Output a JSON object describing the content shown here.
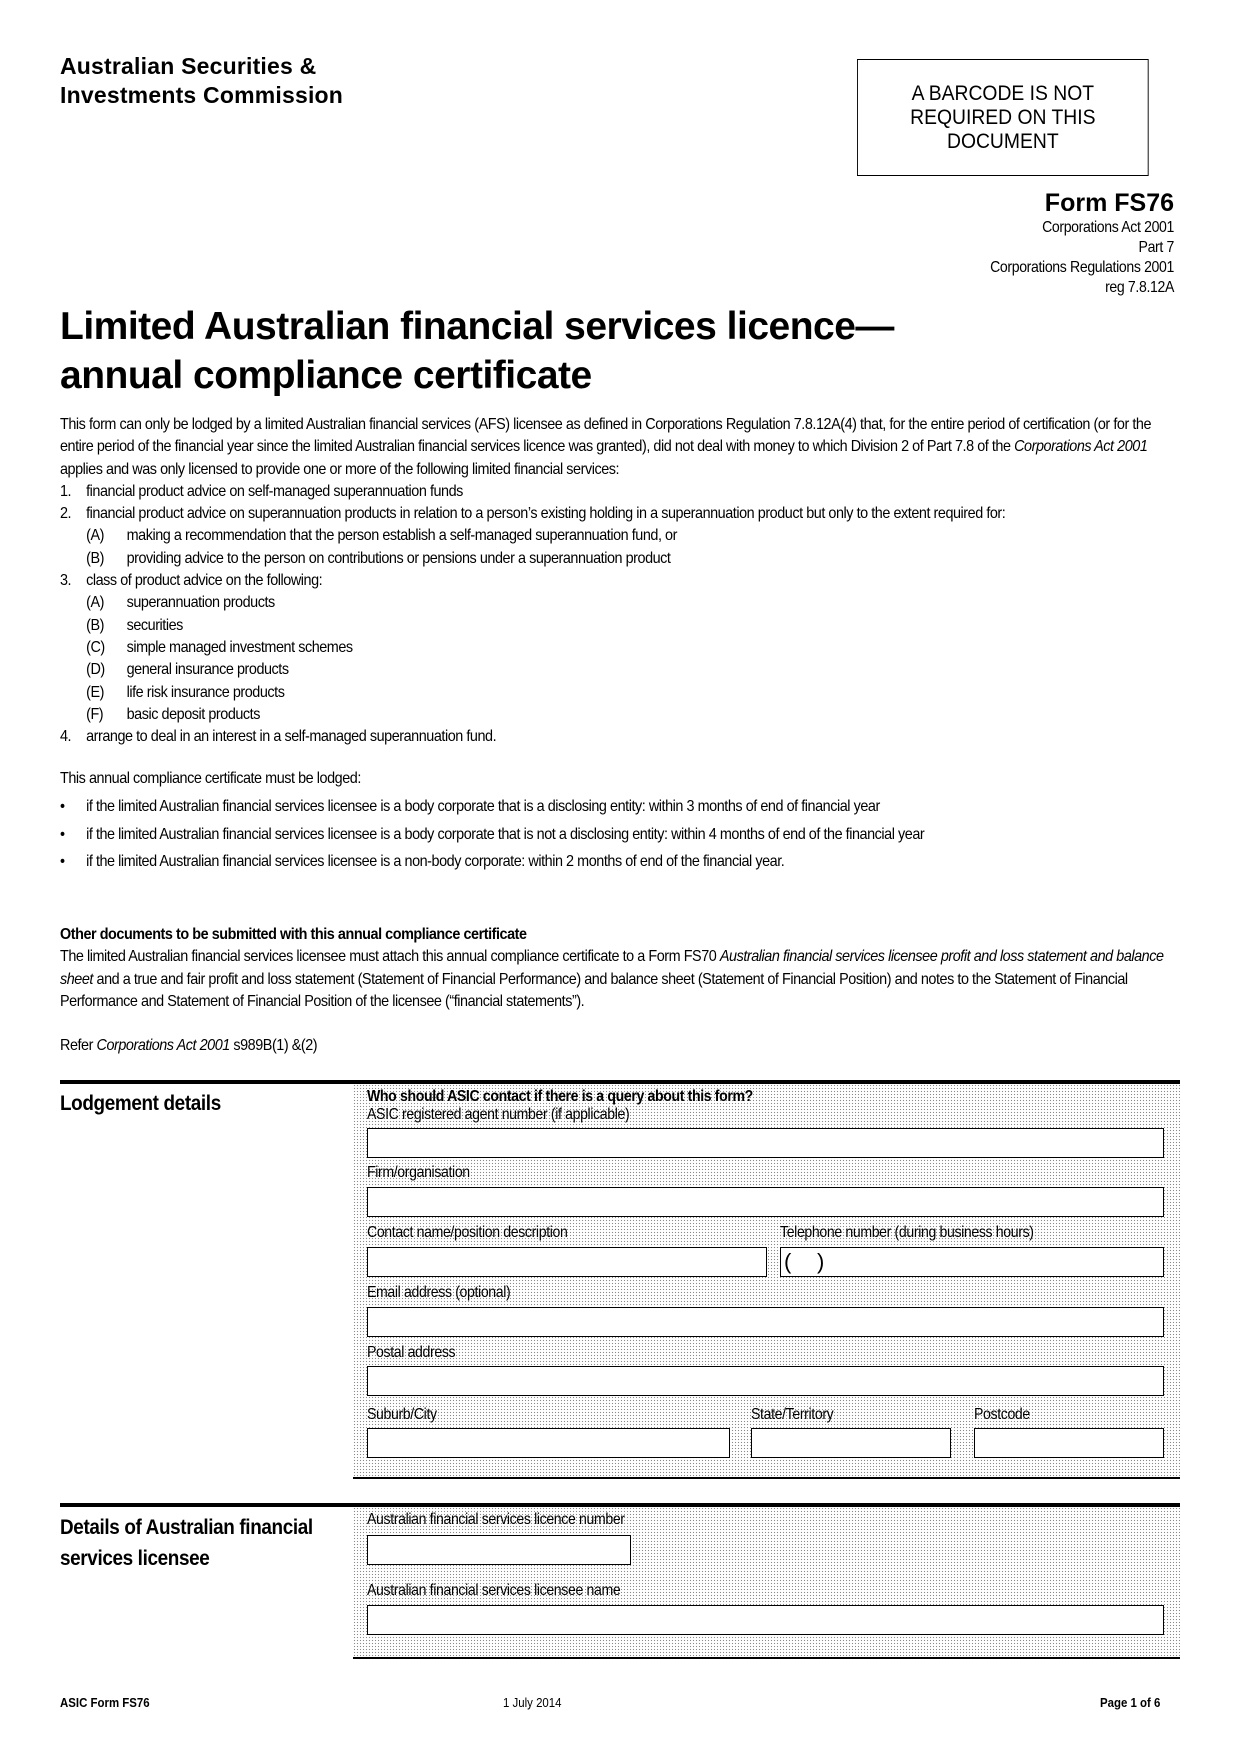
{
  "header": {
    "org_line1": "Australian Securities &",
    "org_line2": "Investments Commission",
    "barcode_notice": [
      "A BARCODE IS NOT",
      "REQUIRED ON THIS",
      "DOCUMENT"
    ],
    "form_id": "Form FS76",
    "legislation": [
      "Corporations Act 2001",
      "Part 7",
      "Corporations Regulations 2001",
      "reg 7.8.12A"
    ]
  },
  "title": {
    "line1": "Limited Australian financial services licence—",
    "line2": "annual compliance certificate"
  },
  "intro": {
    "para_pre": "This form can only be lodged by a limited Australian financial services (AFS) licensee as defined in Corporations Regulation 7.8.12A(4) that, for the entire period of certification (or for the entire period of the financial year since the limited Australian financial services licence was granted), did not deal with money to which Division 2 of Part 7.8 of the ",
    "para_italic": "Corporations Act 2001",
    "para_post": " applies and was only licensed to provide one or more of the following limited financial services:",
    "items": [
      {
        "num": "1.",
        "text": "financial product advice on self-managed superannuation funds",
        "subs": []
      },
      {
        "num": "2.",
        "text": "financial product advice on superannuation products in relation to a person’s existing holding in a superannuation product but only to the extent required for:",
        "subs": [
          {
            "label": "(A)",
            "text": "making a recommendation that the person establish a self-managed superannuation fund, or"
          },
          {
            "label": "(B)",
            "text": "providing advice to the person on contributions or pensions under a superannuation product"
          }
        ]
      },
      {
        "num": "3.",
        "text": "class of product advice on the following:",
        "subs": [
          {
            "label": "(A)",
            "text": "superannuation products"
          },
          {
            "label": "(B)",
            "text": "securities"
          },
          {
            "label": "(C)",
            "text": "simple managed investment schemes"
          },
          {
            "label": "(D)",
            "text": "general insurance products"
          },
          {
            "label": "(E)",
            "text": "life risk insurance products"
          },
          {
            "label": "(F)",
            "text": "basic deposit products"
          }
        ]
      },
      {
        "num": "4.",
        "text": "arrange to deal in an interest in a self-managed superannuation fund.",
        "subs": []
      }
    ]
  },
  "lodgement_timing": {
    "intro": "This annual compliance certificate must be lodged:",
    "bullet_char": "•",
    "bullets": [
      "if the limited Australian financial services licensee is a body corporate that is a disclosing entity: within 3 months of end of financial year",
      "if the limited Australian financial services licensee is a body corporate that is not a disclosing entity: within 4 months of end of the financial year",
      "if the limited Australian financial services licensee is a non-body corporate: within 2 months of end of the financial year."
    ]
  },
  "other_documents": {
    "heading": "Other documents to be submitted with this annual compliance certificate",
    "text_pre": "The limited Australian financial services licensee must attach this annual compliance certificate to a Form FS70 ",
    "text_italic": "Australian financial services licensee profit and loss statement and balance sheet",
    "text_post": " and a true and fair profit and loss statement (Statement of Financial Performance) and balance sheet (Statement of Financial Position) and notes to the Statement of Financial Performance and Statement of Financial Position of the licensee (“financial statements”)."
  },
  "refer": {
    "pre": "Refer ",
    "italic": "Corporations Act 2001",
    "post": " s989B(1) &(2)"
  },
  "lodgement_details": {
    "section_label": "Lodgement details",
    "question": "Who should ASIC contact if there is a query about this form?",
    "fields": {
      "agent_number": {
        "label": "ASIC registered agent number (if applicable)",
        "value": ""
      },
      "firm": {
        "label": "Firm/organisation",
        "value": ""
      },
      "contact_name": {
        "label": "Contact name/position description",
        "value": ""
      },
      "telephone": {
        "label": "Telephone number (during business hours)",
        "value": "",
        "area_code_open": "(",
        "area_code_close": ")"
      },
      "email": {
        "label": "Email address (optional)",
        "value": ""
      },
      "postal_address": {
        "label": "Postal address",
        "value": ""
      },
      "suburb": {
        "label": "Suburb/City",
        "value": ""
      },
      "state": {
        "label": "State/Territory",
        "value": ""
      },
      "postcode": {
        "label": "Postcode",
        "value": ""
      }
    }
  },
  "licensee_details": {
    "section_label_line1": "Details of Australian financial",
    "section_label_line2": "services licensee",
    "fields": {
      "licence_number": {
        "label": "Australian financial services licence number",
        "value": ""
      },
      "licensee_name": {
        "label": "Australian financial services licensee name",
        "value": ""
      }
    }
  },
  "footer": {
    "form_name": "ASIC Form FS76",
    "date": "1 July 2014",
    "page": "Page 1 of 6"
  }
}
